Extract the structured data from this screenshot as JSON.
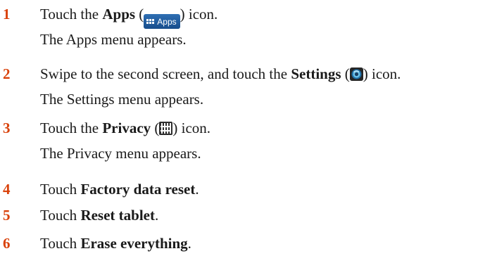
{
  "steps": [
    {
      "num": "1",
      "before": "Touch the ",
      "bold": "Apps",
      "open": " (",
      "close": ") icon.",
      "icon": "apps-icon",
      "icon_text": "Apps",
      "result": "The Apps menu appears."
    },
    {
      "num": "2",
      "before": "Swipe to the second screen, and touch the ",
      "bold": "Settings",
      "open": " (",
      "close": ") icon.",
      "icon": "settings-icon",
      "result": "The Settings menu appears."
    },
    {
      "num": "3",
      "before": "Touch the ",
      "bold": "Privacy",
      "open": " (",
      "close": ") icon.",
      "icon": "privacy-icon",
      "result": "The Privacy menu appears."
    },
    {
      "num": "4",
      "before": "Touch ",
      "bold": "Factory data reset",
      "after": "."
    },
    {
      "num": "5",
      "before": "Touch ",
      "bold": "Reset tablet",
      "after": "."
    },
    {
      "num": "6",
      "before": "Touch ",
      "bold": "Erase everything",
      "after": "."
    }
  ],
  "colors": {
    "step_number": "#d9420b",
    "text": "#1a1a1a",
    "apps_icon_bg": "#1f5c9e"
  }
}
